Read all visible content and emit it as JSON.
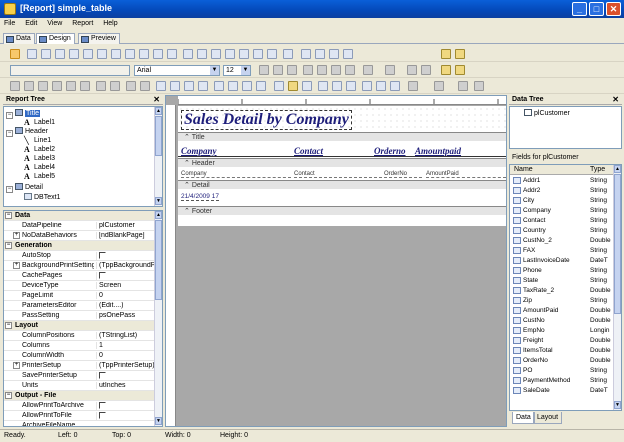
{
  "window": {
    "title": "[Report] simple_table"
  },
  "menu": [
    "File",
    "Edit",
    "View",
    "Report",
    "Help"
  ],
  "view_tabs": [
    "Data",
    "Design",
    "Preview"
  ],
  "format_bar": {
    "font": "Arial",
    "size": "12"
  },
  "report_tree": {
    "header": "Report Tree",
    "nodes": [
      {
        "label": "Title",
        "selected": true
      },
      {
        "label": "Label1"
      },
      {
        "label": "Header"
      },
      {
        "label": "Line1"
      },
      {
        "label": "Label2"
      },
      {
        "label": "Label3"
      },
      {
        "label": "Label4"
      },
      {
        "label": "Label5"
      },
      {
        "label": "Detail"
      },
      {
        "label": "DBText1"
      }
    ]
  },
  "properties": [
    {
      "section": "Data"
    },
    {
      "name": "DataPipeline",
      "value": "plCustomer"
    },
    {
      "name": "NoDataBehaviors",
      "value": "[ndBlankPage]",
      "expandable": true
    },
    {
      "section": "Generation"
    },
    {
      "name": "AutoStop",
      "check": true
    },
    {
      "name": "BackgroundPrintSettings",
      "value": "(TppBackgroundPrintSettings)",
      "expandable": true
    },
    {
      "name": "CachePages",
      "check": true
    },
    {
      "name": "DeviceType",
      "value": "Screen"
    },
    {
      "name": "PageLimit",
      "value": "0"
    },
    {
      "name": "ParametersEditor",
      "value": "(Edit....)"
    },
    {
      "name": "PassSetting",
      "value": "psOnePass"
    },
    {
      "section": "Layout"
    },
    {
      "name": "ColumnPositions",
      "value": "(TStringList)"
    },
    {
      "name": "Columns",
      "value": "1"
    },
    {
      "name": "ColumnWidth",
      "value": "0"
    },
    {
      "name": "PrinterSetup",
      "value": "(TppPrinterSetup)",
      "expandable": true
    },
    {
      "name": "SavePrinterSetup",
      "check": true
    },
    {
      "name": "Units",
      "value": "utInches"
    },
    {
      "section": "Output - File"
    },
    {
      "name": "AllowPrintToArchive",
      "check": true
    },
    {
      "name": "AllowPrintToFile",
      "check": true
    },
    {
      "name": "ArchiveFileName",
      "value": ""
    }
  ],
  "report": {
    "title_text": "Sales Detail by Company",
    "bands": {
      "title": "Title",
      "header": "Header",
      "detail": "Detail",
      "footer": "Footer"
    },
    "header_labels": [
      "Company",
      "Contact",
      "Orderno",
      "Amountpaid"
    ],
    "detail_fields": [
      "Company",
      "Contact",
      "OrderNo",
      "AmountPaid"
    ],
    "date_text": "21/4/2009 17"
  },
  "data_tree": {
    "header": "Data Tree",
    "pipeline": "plCustomer"
  },
  "fields_panel": {
    "title": "Fields for plCustomer",
    "col_name": "Name",
    "col_type": "Type",
    "fields": [
      {
        "name": "Addr1",
        "type": "String"
      },
      {
        "name": "Addr2",
        "type": "String"
      },
      {
        "name": "City",
        "type": "String"
      },
      {
        "name": "Company",
        "type": "String"
      },
      {
        "name": "Contact",
        "type": "String"
      },
      {
        "name": "Country",
        "type": "String"
      },
      {
        "name": "CustNo_2",
        "type": "Double"
      },
      {
        "name": "FAX",
        "type": "String"
      },
      {
        "name": "LastInvoiceDate",
        "type": "DateT"
      },
      {
        "name": "Phone",
        "type": "String"
      },
      {
        "name": "State",
        "type": "String"
      },
      {
        "name": "TaxRate_2",
        "type": "Double"
      },
      {
        "name": "Zip",
        "type": "String"
      },
      {
        "name": "AmountPaid",
        "type": "Double"
      },
      {
        "name": "CustNo",
        "type": "Double"
      },
      {
        "name": "EmpNo",
        "type": "Longin"
      },
      {
        "name": "Freight",
        "type": "Double"
      },
      {
        "name": "ItemsTotal",
        "type": "Double"
      },
      {
        "name": "OrderNo",
        "type": "Double"
      },
      {
        "name": "PO",
        "type": "String"
      },
      {
        "name": "PaymentMethod",
        "type": "String"
      },
      {
        "name": "SaleDate",
        "type": "DateT"
      }
    ],
    "tabs": [
      "Data",
      "Layout"
    ]
  },
  "status": {
    "state": "Ready.",
    "left": "Left: 0",
    "top": "Top: 0",
    "width": "Width: 0",
    "height": "Height: 0"
  }
}
